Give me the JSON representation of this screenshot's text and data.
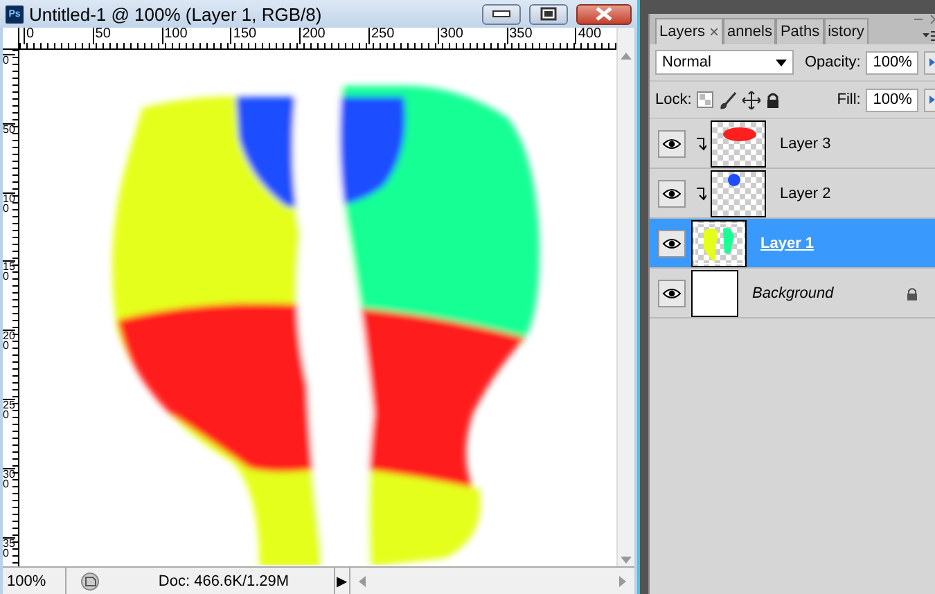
{
  "document": {
    "title": "Untitled-1 @ 100% (Layer 1, RGB/8)",
    "app_badge": "Ps",
    "h_ruler": [
      "0",
      "50",
      "100",
      "150",
      "200",
      "250",
      "300",
      "350",
      "400"
    ],
    "v_ruler": [
      "0",
      "50",
      "100",
      "150",
      "200",
      "250",
      "300",
      "350"
    ],
    "status_bar": {
      "zoom": "100%",
      "doc_info": "Doc: 466.6K/1.29M",
      "menu_arrow": "▶"
    }
  },
  "layers_panel": {
    "tabs": [
      {
        "label": "Layers",
        "selected": true,
        "close": "×"
      },
      {
        "label": "annels",
        "selected": false
      },
      {
        "label": "Paths",
        "selected": false
      },
      {
        "label": "istory",
        "selected": false
      }
    ],
    "blend_mode": "Normal",
    "opacity_label": "Opacity:",
    "opacity": "100%",
    "lock_label": "Lock:",
    "fill_label": "Fill:",
    "fill": "100%",
    "layers": [
      {
        "name": "Layer 3",
        "kind": "layer",
        "visible": true,
        "clipped": true,
        "selected": false,
        "locked": false
      },
      {
        "name": "Layer 2",
        "kind": "layer",
        "visible": true,
        "clipped": true,
        "selected": false,
        "locked": false
      },
      {
        "name": "Layer 1",
        "kind": "layer",
        "visible": true,
        "clipped": false,
        "selected": true,
        "locked": false
      },
      {
        "name": "Background",
        "kind": "background",
        "visible": true,
        "clipped": false,
        "selected": false,
        "locked": true
      }
    ]
  }
}
